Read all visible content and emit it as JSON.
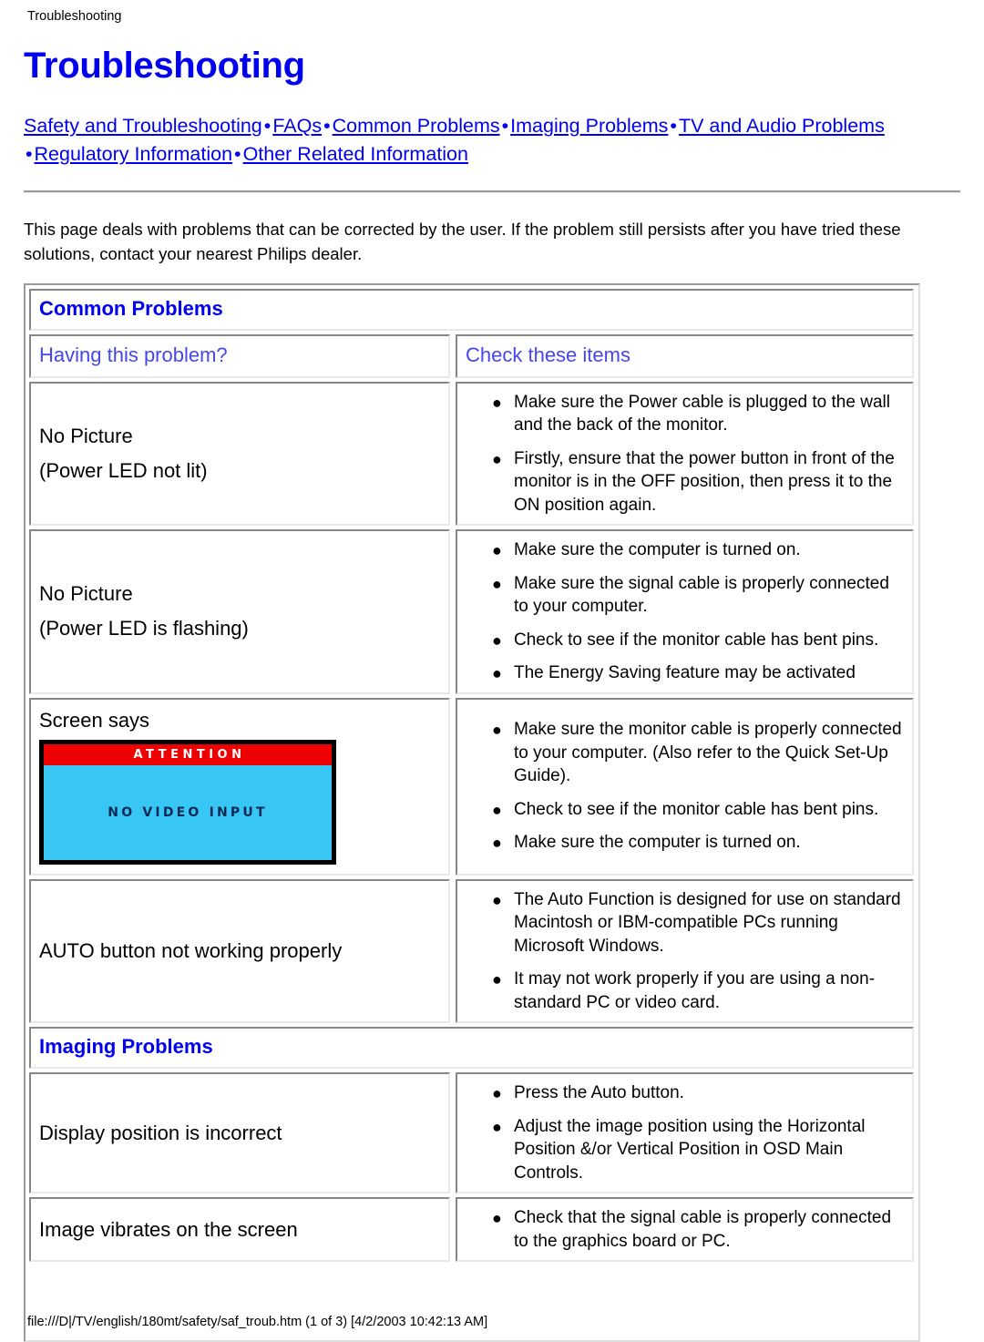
{
  "breadcrumb": "Troubleshooting",
  "title": "Troubleshooting",
  "colors": {
    "link": "#0000EE",
    "heading": "#0000EE",
    "column_head": "#4646EE",
    "attention_bar": "#EE0000",
    "screen_body": "#38C6F4",
    "screen_text": "#0d2a55"
  },
  "linkbar": {
    "separator": "•",
    "links": [
      "Safety and Troubleshooting",
      "FAQs",
      "Common Problems",
      "Imaging Problems",
      "TV and Audio Problems ",
      "Regulatory Information",
      "Other Related Information"
    ]
  },
  "intro": "This page deals with problems that can be corrected by the user. If the problem still persists after you have tried these solutions, contact your nearest Philips dealer.",
  "table": {
    "sections": [
      {
        "title": "Common Problems",
        "column_headers": [
          "Having this problem?",
          "Check these items"
        ],
        "rows": [
          {
            "problem_lines": [
              "No Picture",
              "(Power LED not lit)"
            ],
            "checks": [
              "Make sure the Power cable is plugged to the wall and the back of the monitor.",
              "Firstly, ensure that the power button in front of the monitor is in the OFF position, then press it to the ON position again."
            ]
          },
          {
            "problem_lines": [
              "No Picture",
              "(Power LED is flashing)"
            ],
            "checks": [
              "Make sure the computer is turned on.",
              "Make sure the signal cable is properly connected to your computer.",
              "Check to see if the monitor cable has bent pins.",
              "The Energy Saving feature may be activated"
            ]
          },
          {
            "problem_lines": [
              "Screen says"
            ],
            "graphic": {
              "type": "monitor-osd",
              "attention_label": "ATTENTION",
              "message": "NO VIDEO INPUT"
            },
            "checks": [
              "Make sure the monitor cable is properly connected to your computer. (Also refer to the Quick Set-Up Guide).",
              "Check to see if the monitor cable has bent pins.",
              "Make sure the computer is turned on."
            ]
          },
          {
            "problem_lines": [
              "AUTO button not working properly"
            ],
            "checks": [
              "The Auto Function is designed for use on standard Macintosh or IBM-compatible PCs running Microsoft Windows.",
              "It may not work properly if you are using a non-standard PC or video card."
            ]
          }
        ]
      },
      {
        "title": "Imaging Problems",
        "column_headers": [],
        "rows": [
          {
            "problem_lines": [
              "Display position is incorrect"
            ],
            "checks": [
              "Press the Auto button.",
              "Adjust the image position using the Horizontal Position &/or Vertical Position in OSD Main Controls."
            ]
          },
          {
            "problem_lines": [
              "Image vibrates on the screen"
            ],
            "checks": [
              "Check that the signal cable is properly connected to the graphics board or PC."
            ]
          }
        ]
      }
    ]
  },
  "footer": "file:///D|/TV/english/180mt/safety/saf_troub.htm (1 of 3) [4/2/2003 10:42:13 AM]"
}
